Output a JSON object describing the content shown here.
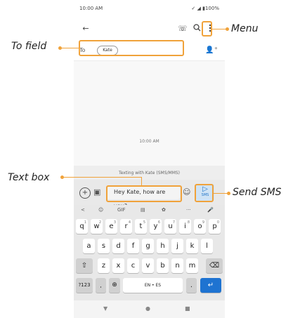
{
  "status_bar": {
    "time": "10:00 AM",
    "indicators": "✓ ◢ ▮100%"
  },
  "toolbar": {
    "back_icon": "arrow-left",
    "call_icon": "phone",
    "search_icon": "search",
    "menu_icon": "more-vert"
  },
  "to_field": {
    "label": "To",
    "chip": "Kate",
    "add_contact_icon": "person-add"
  },
  "conversation": {
    "timestamp": "10:00 AM",
    "texting_with": "Texting with Kate (SMS/MMS)"
  },
  "composer": {
    "text": "Hey Kate, how are you?",
    "send_label": "SMS",
    "plus_icon": "add",
    "gallery_icon": "image",
    "emoji_icon": "emoji"
  },
  "keyboard": {
    "toolbar": [
      "<",
      "☺",
      "GIF",
      "▤",
      "✿",
      "···",
      "🎤"
    ],
    "row1": [
      "q",
      "w",
      "e",
      "r",
      "t",
      "y",
      "u",
      "i",
      "o",
      "p"
    ],
    "row1_num": [
      "1",
      "2",
      "3",
      "4",
      "5",
      "6",
      "7",
      "8",
      "9",
      "0"
    ],
    "row2": [
      "a",
      "s",
      "d",
      "f",
      "g",
      "h",
      "j",
      "k",
      "l"
    ],
    "row3": [
      "z",
      "x",
      "c",
      "v",
      "b",
      "n",
      "m"
    ],
    "sym_key": "?123",
    "space_label": "EN • ES",
    "period": "."
  },
  "annotations": {
    "to_field": "To field",
    "menu": "Menu",
    "text_box": "Text box",
    "send_sms": "Send SMS"
  },
  "colors": {
    "callout": "#f0a23a",
    "accent": "#1e73d1",
    "send_bg": "#cfe3f5"
  }
}
